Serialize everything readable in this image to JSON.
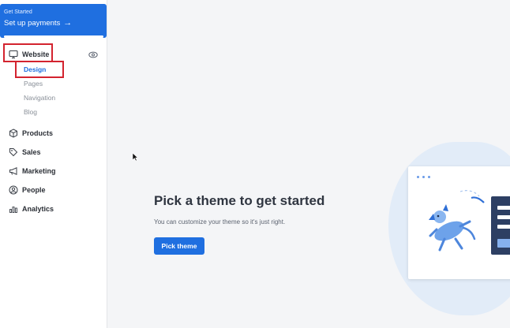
{
  "get_started": {
    "label": "Get Started",
    "title": "Set up payments",
    "progress": 1.0
  },
  "nav": {
    "website": "Website",
    "sub": [
      "Design",
      "Pages",
      "Navigation",
      "Blog"
    ],
    "products": "Products",
    "sales": "Sales",
    "marketing": "Marketing",
    "people": "People",
    "analytics": "Analytics"
  },
  "main": {
    "title": "Pick a theme to get started",
    "subtitle": "You can customize your theme so it's just right.",
    "button": "Pick theme"
  },
  "colors": {
    "accent": "#1f6fe0",
    "highlight": "#d3232f",
    "illustration_dark": "#2d3f63"
  }
}
